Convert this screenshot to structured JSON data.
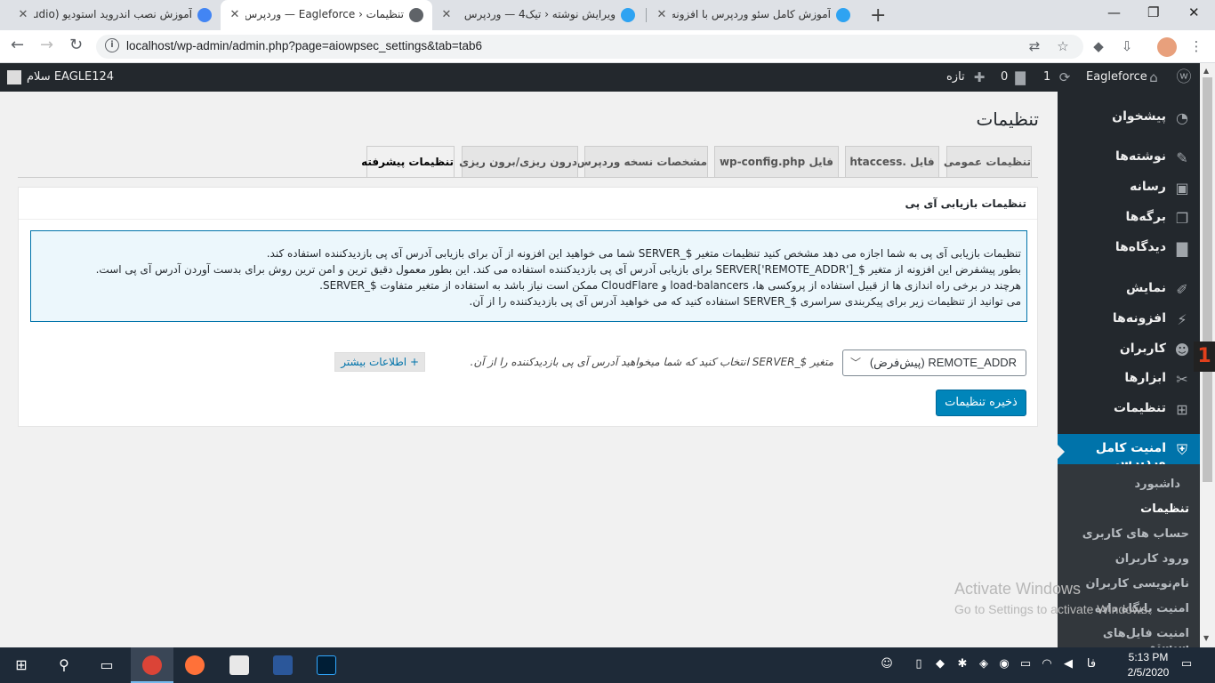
{
  "browser": {
    "tabs": [
      {
        "title": "آموزش نصب اندروید استودیو (Android Studio)",
        "active": false
      },
      {
        "title": "تنظیمات ‹ Eagleforce — وردپرس",
        "active": true
      },
      {
        "title": "ویرایش نوشته ‹ تیک4 — وردپرس",
        "active": false
      },
      {
        "title": "آموزش کامل سئو وردپرس با افزونه",
        "active": false
      }
    ],
    "url": "localhost/wp-admin/admin.php?page=aiowpsec_settings&tab=tab6",
    "new_tab": "+",
    "close": "✕",
    "minimize": "—",
    "maximize": "❐",
    "win_close": "✕"
  },
  "adminbar": {
    "site_name": "Eagleforce",
    "updates_count": "1",
    "comments_count": "0",
    "new_label": "تازه",
    "greeting": "سلام EAGLE124"
  },
  "sidebar": {
    "items": [
      {
        "label": "پیشخوان",
        "icon": "dashboard-icon",
        "glyph": "◔"
      },
      {
        "label": "نوشته‌ها",
        "icon": "pin-icon",
        "glyph": "✎"
      },
      {
        "label": "رسانه",
        "icon": "media-icon",
        "glyph": "▣"
      },
      {
        "label": "برگه‌ها",
        "icon": "pages-icon",
        "glyph": "❐"
      },
      {
        "label": "دیدگاه‌ها",
        "icon": "comments-icon",
        "glyph": "▇"
      },
      {
        "label": "نمایش",
        "icon": "appearance-icon",
        "glyph": "✐"
      },
      {
        "label": "افزونه‌ها",
        "icon": "plugins-icon",
        "glyph": "⚡"
      },
      {
        "label": "کاربران",
        "icon": "users-icon",
        "glyph": "☻"
      },
      {
        "label": "ابزارها",
        "icon": "tools-icon",
        "glyph": "✂"
      },
      {
        "label": "تنظیمات",
        "icon": "settings-icon",
        "glyph": "⊞"
      }
    ],
    "security": {
      "label": "امنیت کامل وردپرس",
      "icon": "shield-icon",
      "glyph": "⛨"
    },
    "submenu": [
      {
        "label": "داشبورد",
        "current": false
      },
      {
        "label": "تنظیمات",
        "current": true
      },
      {
        "label": "حساب های کاربری",
        "current": false
      },
      {
        "label": "ورود کاربران",
        "current": false
      },
      {
        "label": "نام‌نویسی کاربران",
        "current": false
      },
      {
        "label": "امنیت پایگاه داده",
        "current": false
      },
      {
        "label": "امنیت فایل‌های سیستم",
        "current": false
      }
    ]
  },
  "page": {
    "title": "تنظیمات",
    "tabs": [
      {
        "label": "تنظیمات عمومی",
        "active": false
      },
      {
        "label": "فایل .htaccess",
        "active": false
      },
      {
        "label": "فایل wp-config.php",
        "active": false
      },
      {
        "label": "مشخصات نسخه وردپرس",
        "active": false
      },
      {
        "label": "درون ریزی/برون ریزی",
        "active": false
      },
      {
        "label": "تنظیمات پیشرفته",
        "active": true
      }
    ],
    "box_title": "تنظیمات بازیابی آی پی",
    "info_lines": [
      "تنظیمات بازیابی آی پی به شما اجازه می دهد مشخص کنید تنظیمات متغیر $_SERVER شما می خواهید این افزونه از آن برای بازیابی آدرس آی پی بازدیدکننده استفاده کند.",
      "بطور پیشفرض این افزونه از متغیر $_SERVER['REMOTE_ADDR'] برای بازیابی آدرس آی پی بازدیدکننده استفاده می کند. این بطور معمول دقیق ترین و امن ترین روش برای بدست آوردن آدرس آی پی است.",
      "هرچند در برخی راه اندازی ها از قبیل استفاده از پروکسی ها، load-balancers و CloudFlare ممکن است نیاز باشد به استفاده از متغیر متفاوت $_SERVER.",
      "می توانید از تنظیمات زیر برای پیکربندی سراسری $_SERVER استفاده کنید که می خواهید آدرس آی پی بازدیدکننده را از آن."
    ],
    "select_value": "REMOTE_ADDR (پیش‌فرض)",
    "select_description": "متغیر $_SERVER انتخاب کنید که شما میخواهید آدرس آی پی بازدیدکننده را از آن.",
    "more_info": "+ اطلاعات بیشتر",
    "save_label": "ذخیره تنظیمات"
  },
  "watermark": {
    "line1": "Activate Windows",
    "line2": "Go to Settings to activate Windows."
  },
  "taskbar": {
    "time": "5:13 PM",
    "date": "2/5/2020",
    "lang": "فا"
  }
}
